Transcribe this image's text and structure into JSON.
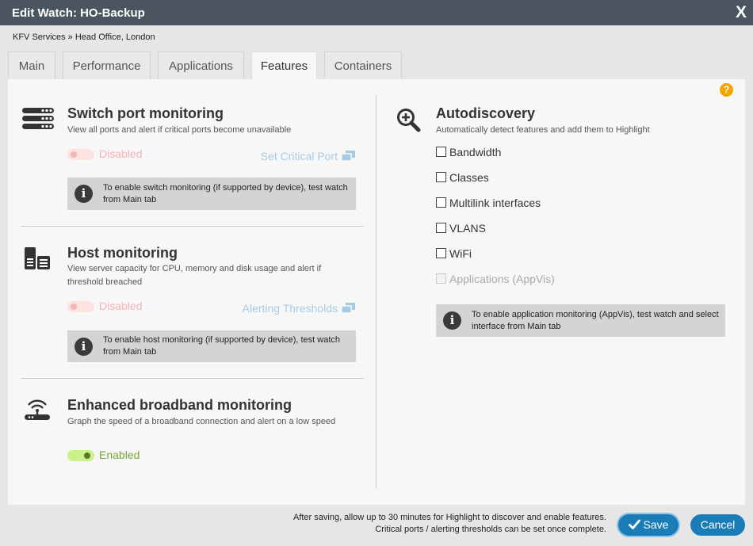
{
  "window": {
    "title": "Edit Watch: HO-Backup",
    "close_label": "X"
  },
  "breadcrumb": "KFV Services » Head Office, London",
  "tabs": [
    {
      "label": "Main"
    },
    {
      "label": "Performance"
    },
    {
      "label": "Applications"
    },
    {
      "label": "Features",
      "active": true
    },
    {
      "label": "Containers"
    }
  ],
  "help_label": "?",
  "switch_port": {
    "icon": "switch-icon",
    "title": "Switch port monitoring",
    "description": "View all ports and alert if critical ports become unavailable",
    "toggle_label": "Disabled",
    "link_label": "Set Critical Port",
    "info_text": "To enable switch monitoring (if supported by device), test watch from Main tab"
  },
  "host": {
    "icon": "server-icon",
    "title": "Host monitoring",
    "description": "View server capacity for CPU, memory and disk usage and alert if threshold breached",
    "toggle_label": "Disabled",
    "link_label": "Alerting Thresholds",
    "info_text": "To enable host monitoring (if supported by device), test watch from Main tab"
  },
  "broadband": {
    "icon": "router-icon",
    "title": "Enhanced broadband monitoring",
    "description": "Graph the speed of a broadband connection and alert on a low speed",
    "toggle_label": "Enabled"
  },
  "autodiscovery": {
    "icon": "magnify-plus-icon",
    "title": "Autodiscovery",
    "description": "Automatically detect features and add them to Highlight",
    "options": [
      {
        "label": "Bandwidth",
        "checked": false
      },
      {
        "label": "Classes",
        "checked": false
      },
      {
        "label": "Multilink interfaces",
        "checked": false
      },
      {
        "label": "VLANS",
        "checked": false
      },
      {
        "label": "WiFi",
        "checked": false
      },
      {
        "label": "Applications (AppVis)",
        "checked": false,
        "disabled": true
      }
    ],
    "info_text": "To enable application monitoring (AppVis), test watch and select interface from Main tab"
  },
  "footer": {
    "note_line1": "After saving, allow up to 30 minutes for Highlight to discover and enable features.",
    "note_line2": "Critical ports / alerting thresholds can be set once complete.",
    "save_label": "Save",
    "cancel_label": "Cancel"
  },
  "colors": {
    "titlebar": "#4a5560",
    "accent": "#1a7db7",
    "help": "#f0a500",
    "disabled_toggle": "#f4b4b4",
    "enabled_toggle": "#7aa33a",
    "link": "#a8cbe4"
  }
}
